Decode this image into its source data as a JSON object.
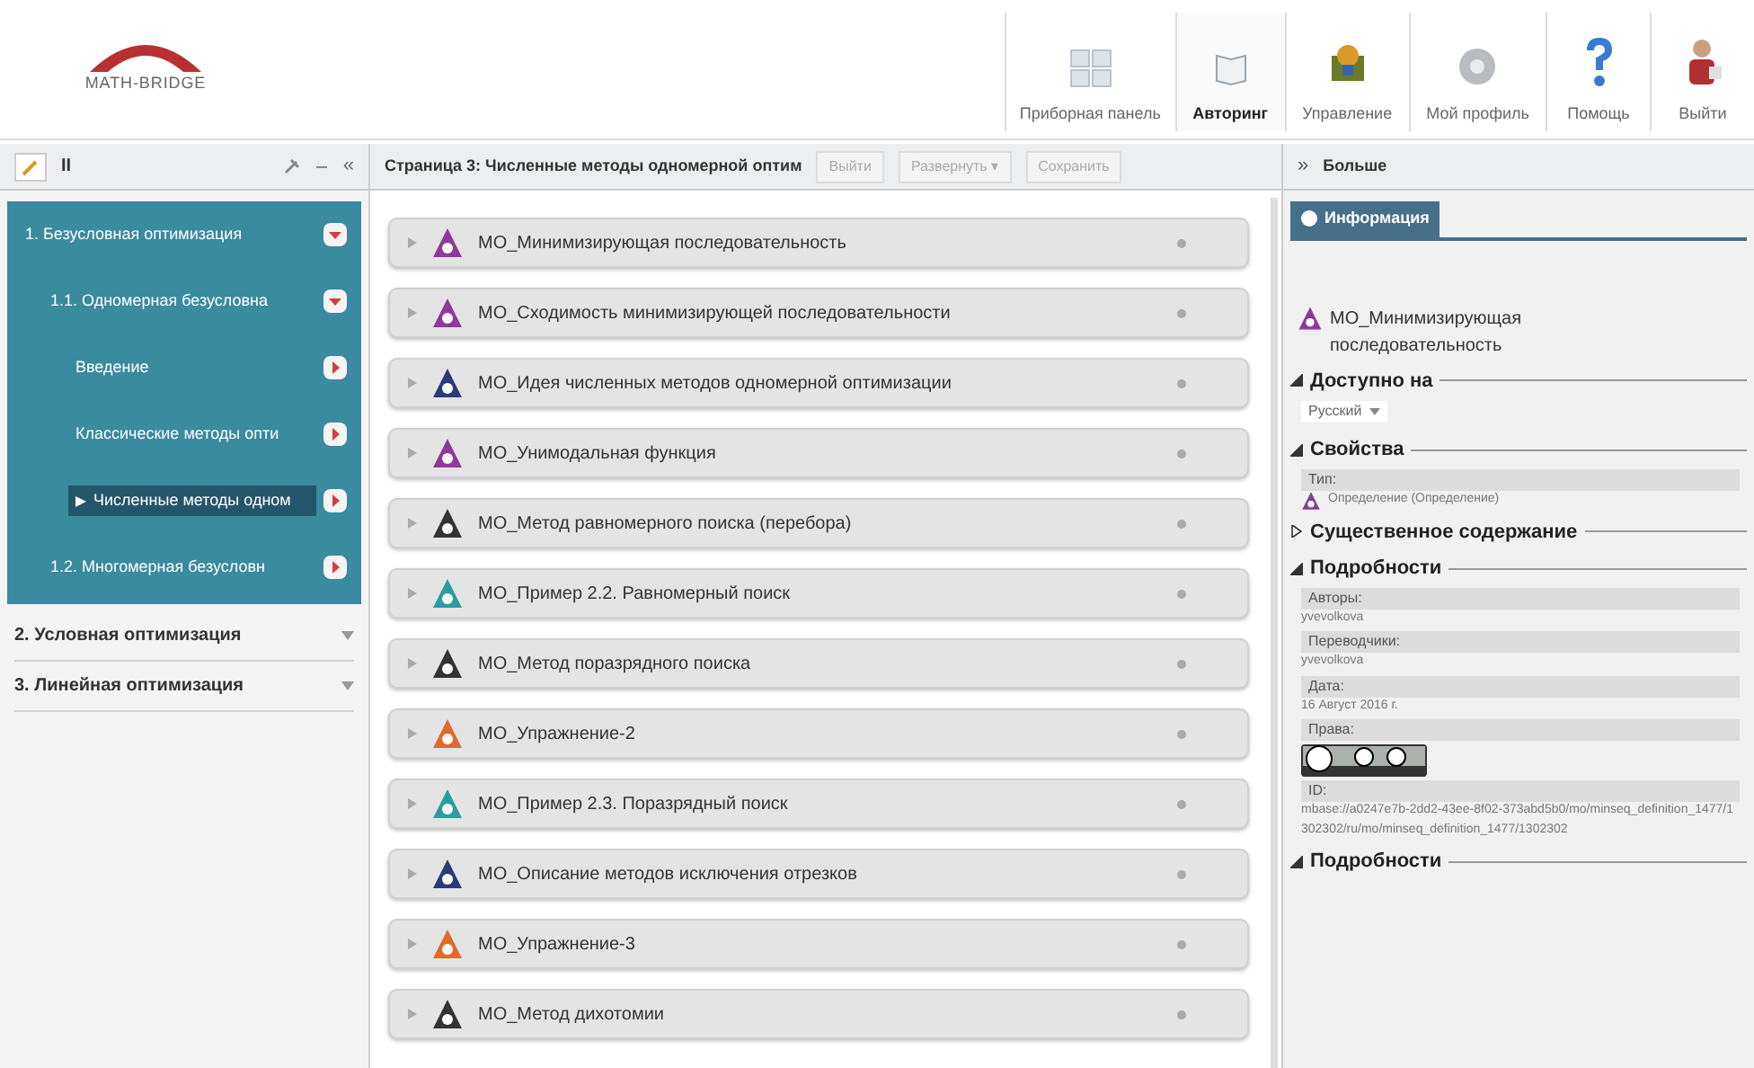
{
  "header": {
    "logo": "MATH-BRIDGE",
    "nav": [
      {
        "label": "Приборная панель",
        "selected": false
      },
      {
        "label": "Авторинг",
        "selected": true
      },
      {
        "label": "Управление",
        "selected": false
      },
      {
        "label": "Мой профиль",
        "selected": false
      },
      {
        "label": "Помощь",
        "selected": false
      },
      {
        "label": "Выйти",
        "selected": false
      }
    ]
  },
  "left_toolbar": {
    "pause": "II",
    "collapse": "«"
  },
  "tree": [
    {
      "label": "1. Безусловная оптимизация",
      "selected": false,
      "expanded": true,
      "children": [
        {
          "label": "1.1. Одномерная безусловна",
          "selected": false,
          "expanded": true,
          "children": [
            {
              "label": "Введение",
              "selected": false
            },
            {
              "label": "Классические методы опти",
              "selected": false
            },
            {
              "label": "Численные методы одном",
              "selected": true
            }
          ]
        },
        {
          "label": "1.2. Многомерная безусловн",
          "selected": false,
          "expanded": false
        }
      ]
    },
    {
      "label": "2. Условная оптимизация",
      "selected": false,
      "expanded": false
    },
    {
      "label": "3. Линейная оптимизация",
      "selected": false,
      "expanded": false
    }
  ],
  "center": {
    "title": "Страница 3: Численные методы одномерной оптим",
    "buttons": [
      "Выйти",
      "Развернуть ▾",
      "Сохранить"
    ],
    "items": [
      {
        "label": "MO_Минимизирующая последовательность",
        "color": "#8b3a9a"
      },
      {
        "label": "MO_Сходимость минимизирующей последовательности",
        "color": "#8b3a9a"
      },
      {
        "label": "MO_Идея численных методов одномерной оптимизации",
        "color": "#2c3a7a"
      },
      {
        "label": "MO_Унимодальная функция",
        "color": "#8b3a9a"
      },
      {
        "label": "MO_Метод равномерного поиска (перебора)",
        "color": "#333333"
      },
      {
        "label": "MO_Пример 2.2. Равномерный поиск",
        "color": "#2a9d9d"
      },
      {
        "label": "MO_Метод поразрядного поиска",
        "color": "#333333"
      },
      {
        "label": "MO_Упражнение-2",
        "color": "#e06a2a"
      },
      {
        "label": "MO_Пример 2.3. Поразрядный поиск",
        "color": "#2a9d9d"
      },
      {
        "label": "MO_Описание методов исключения отрезков",
        "color": "#2c3a7a"
      },
      {
        "label": "MO_Упражнение-3",
        "color": "#e06a2a"
      },
      {
        "label": "MO_Метод дихотомии",
        "color": "#333333"
      }
    ]
  },
  "right": {
    "expand": "»",
    "title": "Больше",
    "tab": "Информация",
    "items": [
      {
        "title": "MO_Минимизирующая последовательность",
        "color": "#8b3a9a"
      }
    ],
    "sections": [
      {
        "title": "Доступно на",
        "expanded": true,
        "kind": "select",
        "value": "Русский"
      },
      {
        "title": "Свойства",
        "expanded": true,
        "kind": "fields",
        "fields": [
          {
            "label": "Тип:",
            "value": "Определение (Определение)",
            "color": "#8b3a9a"
          }
        ]
      },
      {
        "title": "Существенное содержание",
        "expanded": false,
        "kind": "empty"
      },
      {
        "title": "Подробности",
        "expanded": true,
        "kind": "fields",
        "fields": [
          {
            "label": "Авторы:",
            "value": "yvevolkova"
          },
          {
            "label": "Переводчики:",
            "value": "yvevolkova"
          },
          {
            "label": "Дата:",
            "value": "16 Август 2016 г."
          },
          {
            "label": "Права:",
            "license": true
          },
          {
            "label": "ID:",
            "value": "mbase://a0247e7b-2dd2-43ee-8f02-373abd5b0/mo/minseq_definition_1477/1302302/ru/mo/minseq_definition_1477/1302302"
          }
        ]
      },
      {
        "title": "Подробности",
        "expanded": true,
        "kind": "empty"
      }
    ]
  }
}
